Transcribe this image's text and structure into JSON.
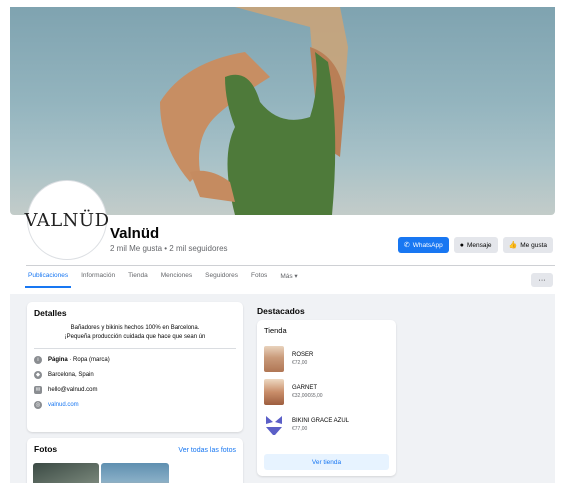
{
  "page": {
    "logo_text": "VALNÜD",
    "name": "Valnüd",
    "stats": "2 mil Me gusta • 2 mil seguidores"
  },
  "actions": {
    "whatsapp_label": "WhatsApp",
    "message_label": "Mensaje",
    "like_label": "Me gusta"
  },
  "tabs": [
    {
      "label": "Publicaciones",
      "active": true
    },
    {
      "label": "Información"
    },
    {
      "label": "Tienda"
    },
    {
      "label": "Menciones"
    },
    {
      "label": "Seguidores"
    },
    {
      "label": "Fotos"
    },
    {
      "label": "Más ▾"
    }
  ],
  "more_button_label": "···",
  "details": {
    "title": "Detalles",
    "bio_line1": "Bañadores y bikinis hechos 100% en Barcelona.",
    "bio_line2": "¡Pequeña producción cuidada que hace que sean ún",
    "category_label": "Página",
    "category_value": " · Ropa (marca)",
    "location": "Barcelona, Spain",
    "email": "hello@valnud.com",
    "website": "valnud.com"
  },
  "photos": {
    "title": "Fotos",
    "see_all": "Ver todas las fotos"
  },
  "featured": {
    "title": "Destacados",
    "shop_title": "Tienda",
    "products": [
      {
        "name": "ROSER",
        "price": "€72,00"
      },
      {
        "name": "GARNET",
        "price": "€32,00€65,00"
      },
      {
        "name": "BIKINI GRACE AZUL",
        "price": "€77,00"
      }
    ],
    "shop_button": "Ver tienda"
  },
  "colors": {
    "accent": "#1877f2",
    "swimsuit": "#4e7a3a",
    "bikini_blue": "#5b5fc7"
  }
}
